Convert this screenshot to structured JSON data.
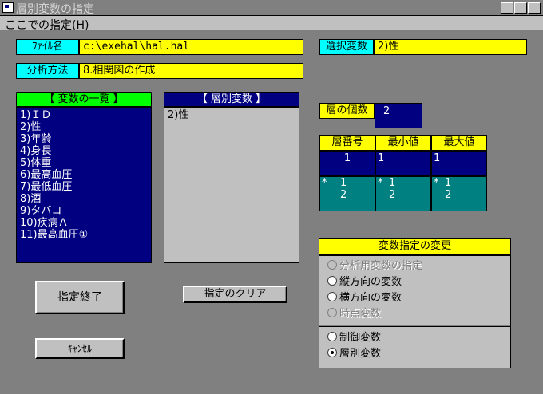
{
  "window": {
    "title": "層別変数の指定"
  },
  "menu": {
    "item": "ここでの指定(H)"
  },
  "file": {
    "label": "ﾌｧｲﾙ名",
    "value": "c:\\exehal\\hal.hal"
  },
  "analysis": {
    "label": "分析方法",
    "value": "8.相関図の作成"
  },
  "selected_var": {
    "label": "選択変数",
    "value": "2)性"
  },
  "var_list": {
    "header": "【 変数の一覧 】",
    "items": [
      "1)ＩＤ",
      "2)性",
      "3)年齢",
      "4)身長",
      "5)体重",
      "6)最高血圧",
      "7)最低血圧",
      "8)酒",
      "9)タバコ",
      "10)疾病Ａ",
      "11)最高血圧①"
    ]
  },
  "strat_list": {
    "header": "【 層別変数 】",
    "items": [
      "2)性"
    ]
  },
  "layer_count": {
    "label": "層の個数",
    "value": "2"
  },
  "layer_table": {
    "headers": [
      "層番号",
      "最小値",
      "最大値"
    ],
    "row1": [
      "1",
      "1",
      "1"
    ],
    "row2": [
      {
        "mark": "*",
        "values": [
          "1",
          "2"
        ]
      },
      {
        "mark": "*",
        "values": [
          "1",
          "2"
        ]
      },
      {
        "mark": "*",
        "values": [
          "1",
          "2"
        ]
      }
    ]
  },
  "change_group": {
    "title": "変数指定の変更",
    "options": [
      {
        "label": "分析用変数の指定",
        "enabled": false,
        "selected": false
      },
      {
        "label": "縦方向の変数",
        "enabled": true,
        "selected": false
      },
      {
        "label": "横方向の変数",
        "enabled": true,
        "selected": false
      },
      {
        "label": "時点変数",
        "enabled": false,
        "selected": false
      }
    ],
    "options2": [
      {
        "label": "制御変数",
        "enabled": true,
        "selected": false
      },
      {
        "label": "層別変数",
        "enabled": true,
        "selected": true
      }
    ]
  },
  "buttons": {
    "finish": "指定終了",
    "clear": "指定のクリア",
    "cancel": "ｷｬﾝｾﾙ"
  },
  "window_buttons": {
    "minimize": "_",
    "maximize": "□",
    "close": "×"
  },
  "colors": {
    "navy": "#000080",
    "teal": "#008080",
    "yellow": "#ffff00",
    "cyan": "#00ffff",
    "green": "#00ff00",
    "bg": "#808080"
  }
}
